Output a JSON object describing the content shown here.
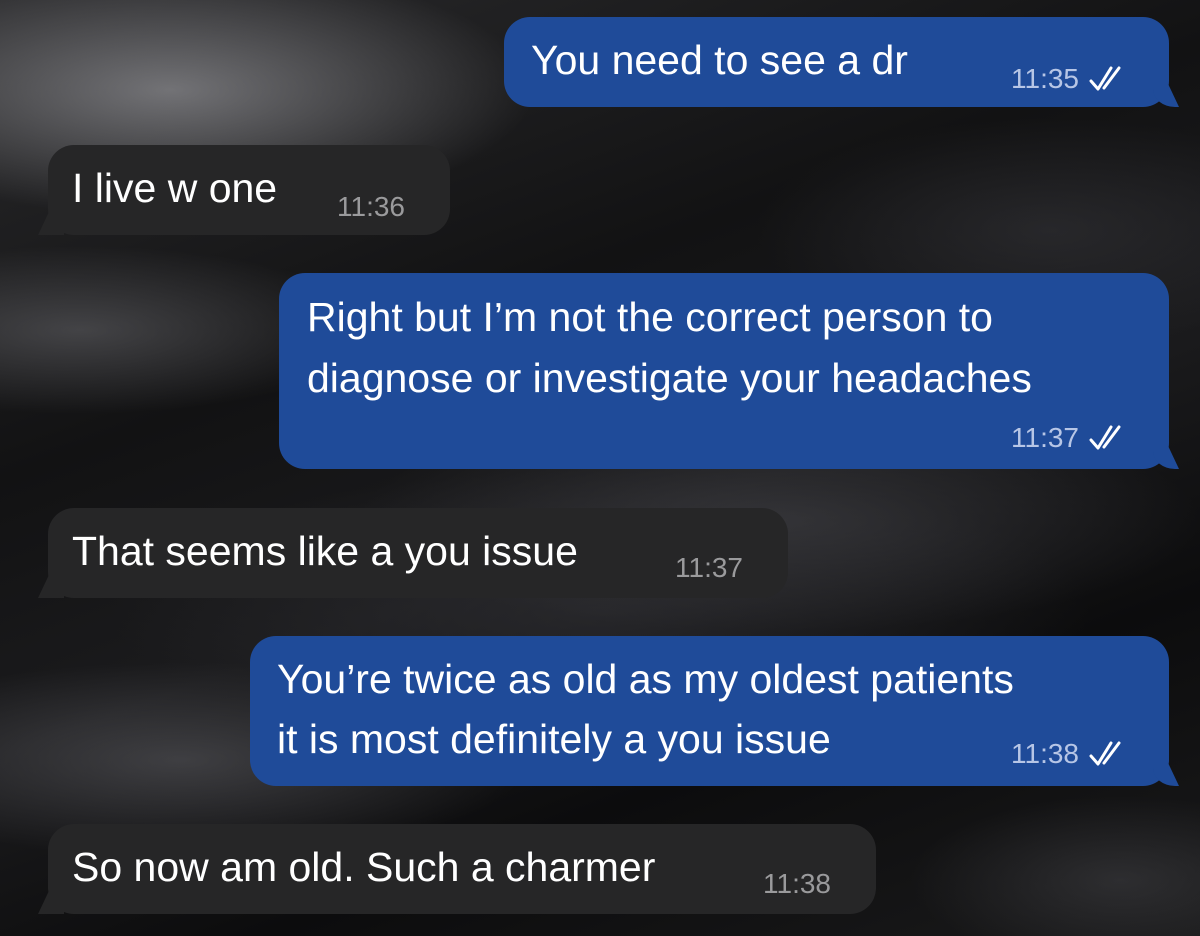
{
  "conversation": {
    "messages": [
      {
        "direction": "outgoing",
        "lines": [
          "You need to see a dr"
        ],
        "time": "11:35",
        "status": "read"
      },
      {
        "direction": "incoming",
        "lines": [
          "I live w one"
        ],
        "time": "11:36"
      },
      {
        "direction": "outgoing",
        "lines": [
          "Right but I’m not the correct person to",
          "diagnose or investigate your headaches"
        ],
        "time": "11:37",
        "status": "read"
      },
      {
        "direction": "incoming",
        "lines": [
          "That seems like a you issue"
        ],
        "time": "11:37"
      },
      {
        "direction": "outgoing",
        "lines": [
          "You’re twice as old as my oldest patients",
          "it is most definitely a you issue"
        ],
        "time": "11:38",
        "status": "read"
      },
      {
        "direction": "incoming",
        "lines": [
          "So now am old. Such a charmer"
        ],
        "time": "11:38"
      }
    ]
  },
  "colors": {
    "outgoing_bubble": "#1f4b99",
    "incoming_bubble": "#262627",
    "text": "#ffffff",
    "outgoing_meta": "#b7c6e6",
    "incoming_meta": "#9a9a9c"
  },
  "icons": {
    "read_receipt": "double-check-icon"
  }
}
